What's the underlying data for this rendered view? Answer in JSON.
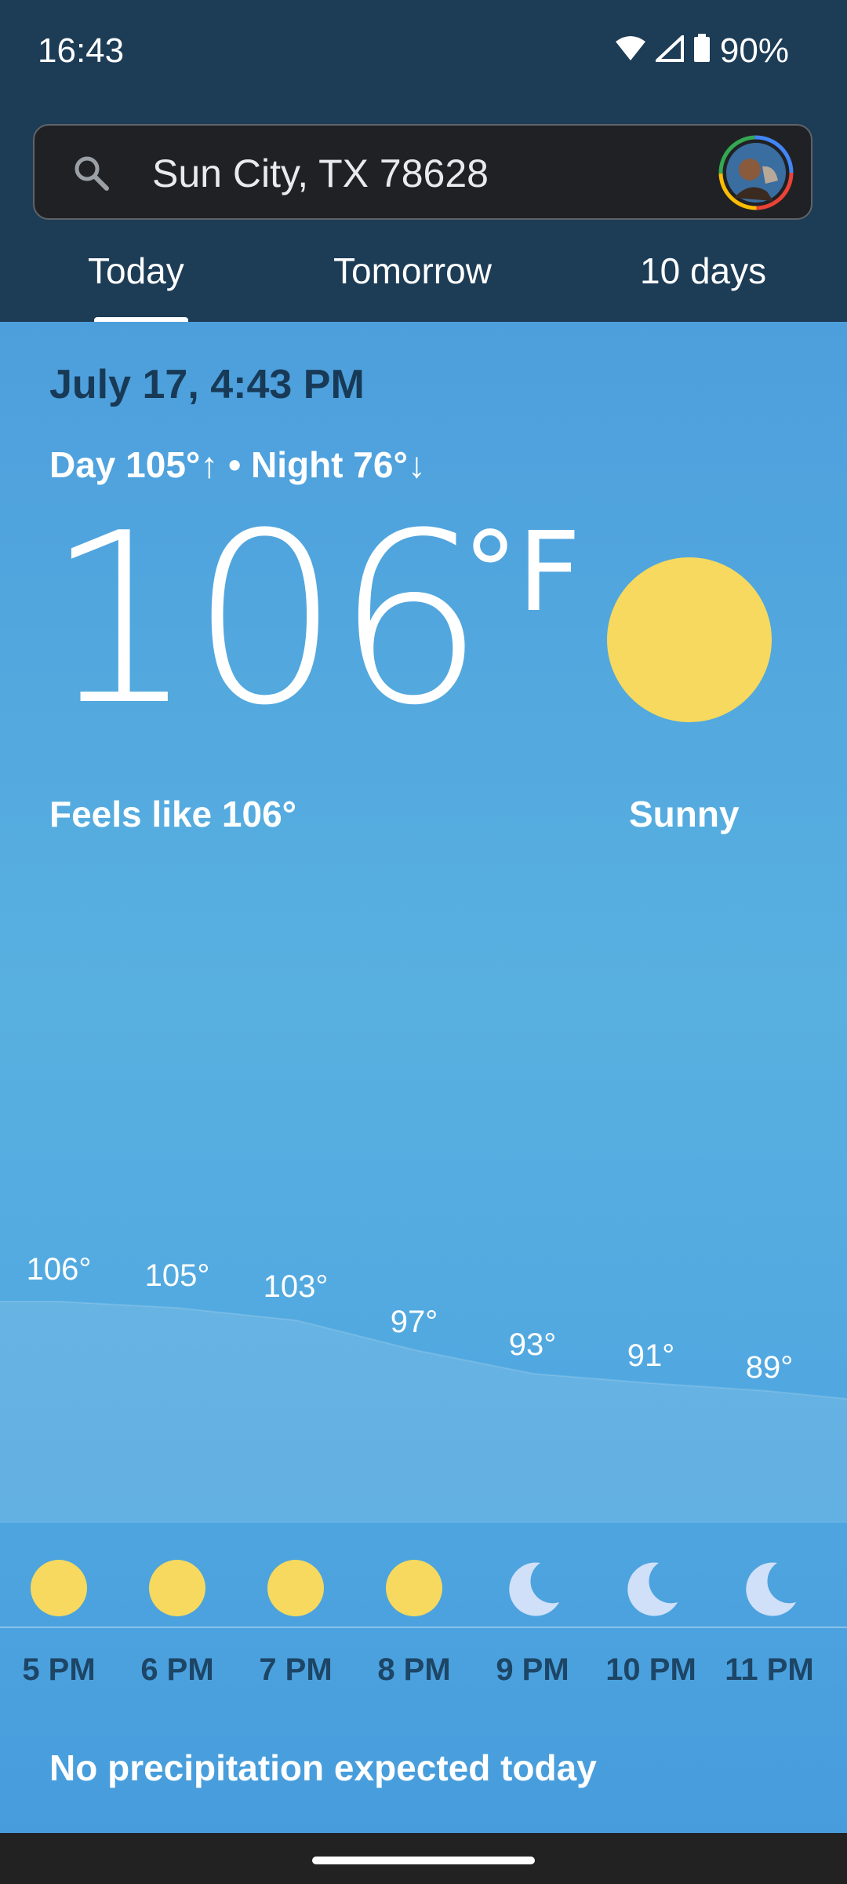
{
  "status": {
    "time": "16:43",
    "battery": "90%"
  },
  "search": {
    "location": "Sun City, TX 78628"
  },
  "tabs": [
    "Today",
    "Tomorrow",
    "10 days"
  ],
  "weather": {
    "date": "July 17, 4:43 PM",
    "day_night": "Day 105°↑ • Night 76°↓",
    "temperature": "106",
    "unit": "°F",
    "feels_like": "Feels like 106°",
    "condition": "Sunny",
    "precipitation": "No precipitation expected today"
  },
  "hourly": {
    "temps": [
      "106°",
      "105°",
      "103°",
      "97°",
      "93°",
      "91°",
      "89°"
    ],
    "times": [
      "5 PM",
      "6 PM",
      "7 PM",
      "8 PM",
      "9 PM",
      "10 PM",
      "11 PM"
    ],
    "icons": [
      "sun-icon",
      "sun-icon",
      "sun-icon",
      "sun-icon",
      "moon-icon",
      "moon-icon",
      "moon-icon"
    ]
  },
  "colors": {
    "topbar": "#1d3c56",
    "sun": "#f6d95e",
    "moon": "#cfe0f8",
    "date_text": "#183a57"
  }
}
